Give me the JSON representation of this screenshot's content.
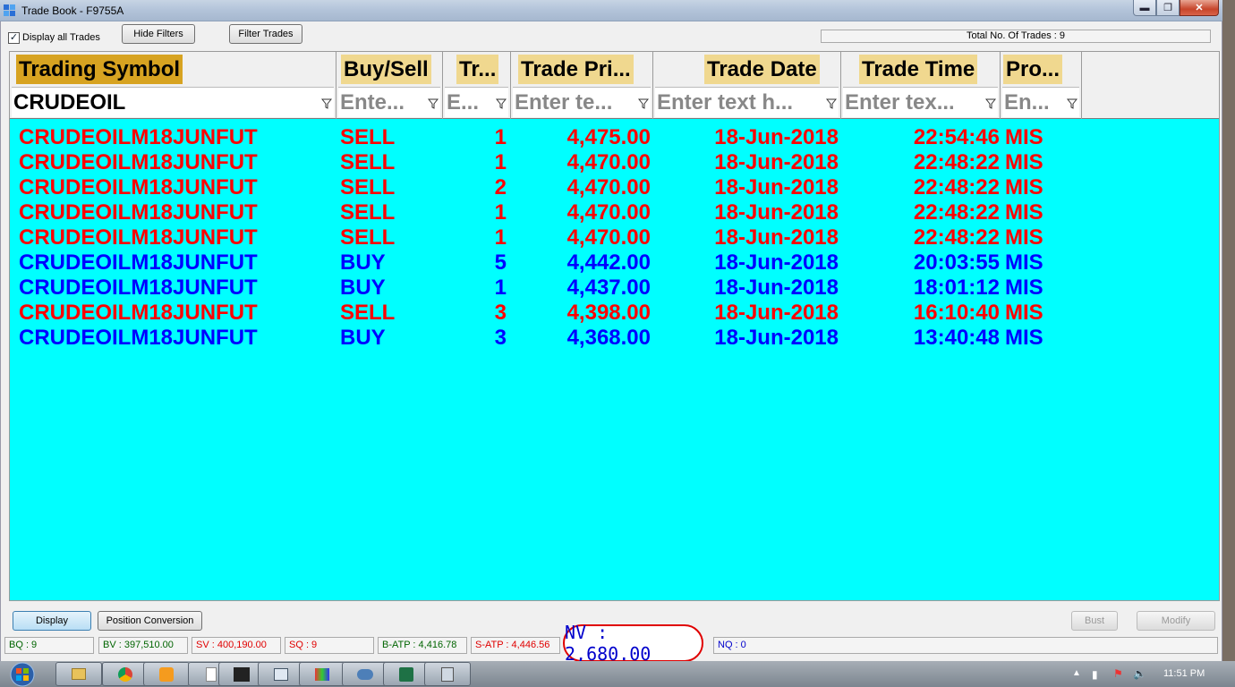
{
  "window": {
    "title": "Trade Book - F9755A"
  },
  "toolbar": {
    "display_all_label": "Display all Trades",
    "display_all_checked": true,
    "hide_filters": "Hide Filters",
    "filter_trades": "Filter Trades",
    "total_trades": "Total No. Of Trades : 9"
  },
  "columns": [
    {
      "title": "Trading Symbol",
      "filter": "CRUDEOIL"
    },
    {
      "title": "Buy/Sell",
      "filter": "Ente..."
    },
    {
      "title": "Tr...",
      "filter": "E..."
    },
    {
      "title": "Trade Pri...",
      "filter": "Enter te..."
    },
    {
      "title": "Trade Date",
      "filter": "Enter text h..."
    },
    {
      "title": "Trade Time",
      "filter": "Enter tex..."
    },
    {
      "title": "Pro...",
      "filter": "En..."
    }
  ],
  "trades": [
    {
      "symbol": "CRUDEOILM18JUNFUT",
      "side": "SELL",
      "qty": "1",
      "price": "4,475.00",
      "date": "18-Jun-2018",
      "time": "22:54:46",
      "product": "MIS"
    },
    {
      "symbol": "CRUDEOILM18JUNFUT",
      "side": "SELL",
      "qty": "1",
      "price": "4,470.00",
      "date": "18-Jun-2018",
      "time": "22:48:22",
      "product": "MIS"
    },
    {
      "symbol": "CRUDEOILM18JUNFUT",
      "side": "SELL",
      "qty": "2",
      "price": "4,470.00",
      "date": "18-Jun-2018",
      "time": "22:48:22",
      "product": "MIS"
    },
    {
      "symbol": "CRUDEOILM18JUNFUT",
      "side": "SELL",
      "qty": "1",
      "price": "4,470.00",
      "date": "18-Jun-2018",
      "time": "22:48:22",
      "product": "MIS"
    },
    {
      "symbol": "CRUDEOILM18JUNFUT",
      "side": "SELL",
      "qty": "1",
      "price": "4,470.00",
      "date": "18-Jun-2018",
      "time": "22:48:22",
      "product": "MIS"
    },
    {
      "symbol": "CRUDEOILM18JUNFUT",
      "side": "BUY",
      "qty": "5",
      "price": "4,442.00",
      "date": "18-Jun-2018",
      "time": "20:03:55",
      "product": "MIS"
    },
    {
      "symbol": "CRUDEOILM18JUNFUT",
      "side": "BUY",
      "qty": "1",
      "price": "4,437.00",
      "date": "18-Jun-2018",
      "time": "18:01:12",
      "product": "MIS"
    },
    {
      "symbol": "CRUDEOILM18JUNFUT",
      "side": "SELL",
      "qty": "3",
      "price": "4,398.00",
      "date": "18-Jun-2018",
      "time": "16:10:40",
      "product": "MIS"
    },
    {
      "symbol": "CRUDEOILM18JUNFUT",
      "side": "BUY",
      "qty": "3",
      "price": "4,368.00",
      "date": "18-Jun-2018",
      "time": "13:40:48",
      "product": "MIS"
    }
  ],
  "colors": {
    "sell": "#ff0000",
    "buy": "#0000ff",
    "grid_bg": "#00ffff",
    "header_highlight": "#d7a321",
    "header_bg": "#f0d88f"
  },
  "bottom": {
    "display": "Display",
    "position_conversion": "Position Conversion",
    "bust": "Bust",
    "modify": "Modify"
  },
  "status": {
    "bq": "BQ : 9",
    "bv": "BV : 397,510.00",
    "sv": "SV : 400,190.00",
    "sq": "SQ : 9",
    "batp": "B-ATP : 4,416.78",
    "satp": "S-ATP : 4,446.56",
    "nv": "NV : 2,680.00",
    "nq": "NQ : 0"
  },
  "taskbar": {
    "clock": "11:51 PM"
  }
}
